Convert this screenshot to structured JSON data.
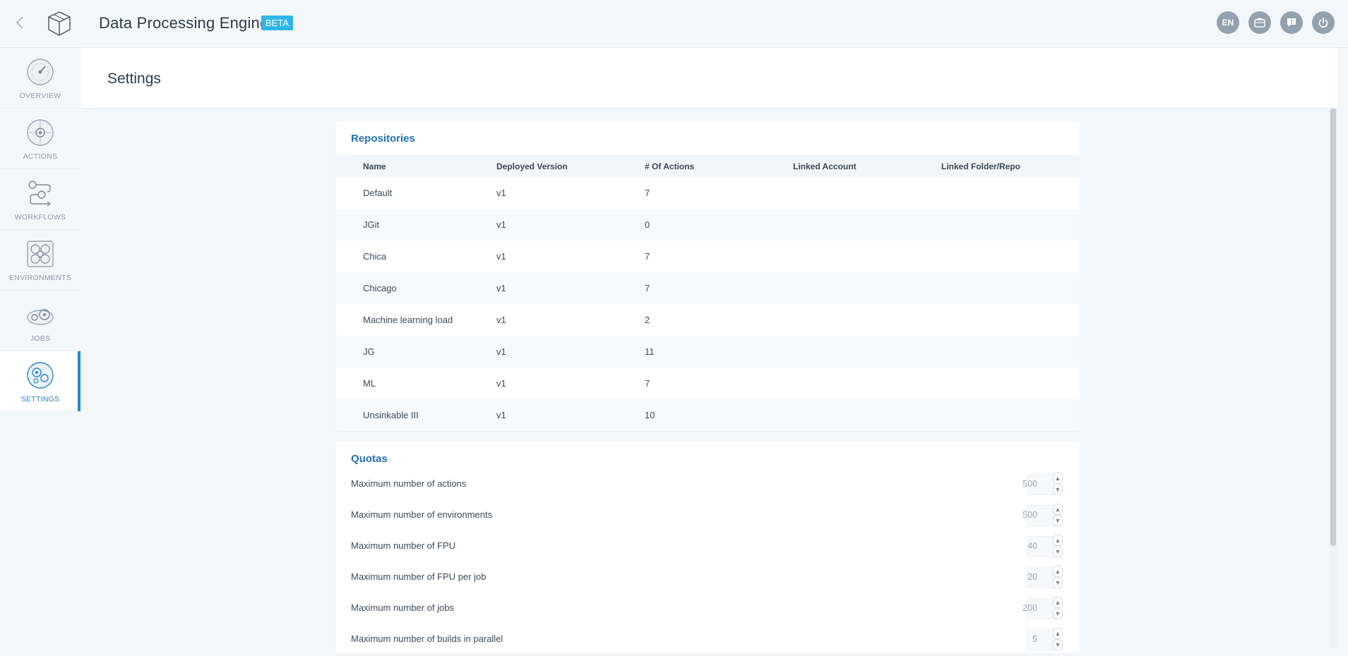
{
  "header": {
    "app_title": "Data Processing Engine",
    "badge": "BETA",
    "lang": "EN",
    "icons": [
      "chevron-left-icon",
      "cube-logo-icon",
      "briefcase-icon",
      "chat-icon",
      "power-icon"
    ]
  },
  "sidebar": {
    "items": [
      {
        "label": "OVERVIEW",
        "icon": "speedometer-icon",
        "active": false
      },
      {
        "label": "ACTIONS",
        "icon": "target-icon",
        "active": false
      },
      {
        "label": "WORKFLOWS",
        "icon": "flow-icon",
        "active": false
      },
      {
        "label": "ENVIRONMENTS",
        "icon": "cluster-icon",
        "active": false
      },
      {
        "label": "JOBS",
        "icon": "gears-icon",
        "active": false
      },
      {
        "label": "SETTINGS",
        "icon": "settings-icon",
        "active": true
      }
    ]
  },
  "page": {
    "title": "Settings"
  },
  "repositories": {
    "title": "Repositories",
    "columns": [
      "Name",
      "Deployed Version",
      "# Of Actions",
      "Linked Account",
      "Linked Folder/Repo"
    ],
    "rows": [
      [
        "Default",
        "v1",
        "7",
        "",
        ""
      ],
      [
        "JGit",
        "v1",
        "0",
        "",
        ""
      ],
      [
        "Chica",
        "v1",
        "7",
        "",
        ""
      ],
      [
        "Chicago",
        "v1",
        "7",
        "",
        ""
      ],
      [
        "Machine learning load",
        "v1",
        "2",
        "",
        ""
      ],
      [
        "JG",
        "v1",
        "11",
        "",
        ""
      ],
      [
        "ML",
        "v1",
        "7",
        "",
        ""
      ],
      [
        "Unsinkable III",
        "v1",
        "10",
        "",
        ""
      ]
    ]
  },
  "quotas": {
    "title": "Quotas",
    "items": [
      {
        "label": "Maximum number of actions",
        "value": "500"
      },
      {
        "label": "Maximum number of environments",
        "value": "500"
      },
      {
        "label": "Maximum number of FPU",
        "value": "40"
      },
      {
        "label": "Maximum number of FPU per job",
        "value": "20"
      },
      {
        "label": "Maximum number of jobs",
        "value": "200"
      },
      {
        "label": "Maximum number of builds in parallel",
        "value": "5"
      }
    ]
  },
  "colors": {
    "accent": "#2a86c9",
    "badge": "#2fb6e8",
    "header_icon_bg": "#93a0ae"
  }
}
